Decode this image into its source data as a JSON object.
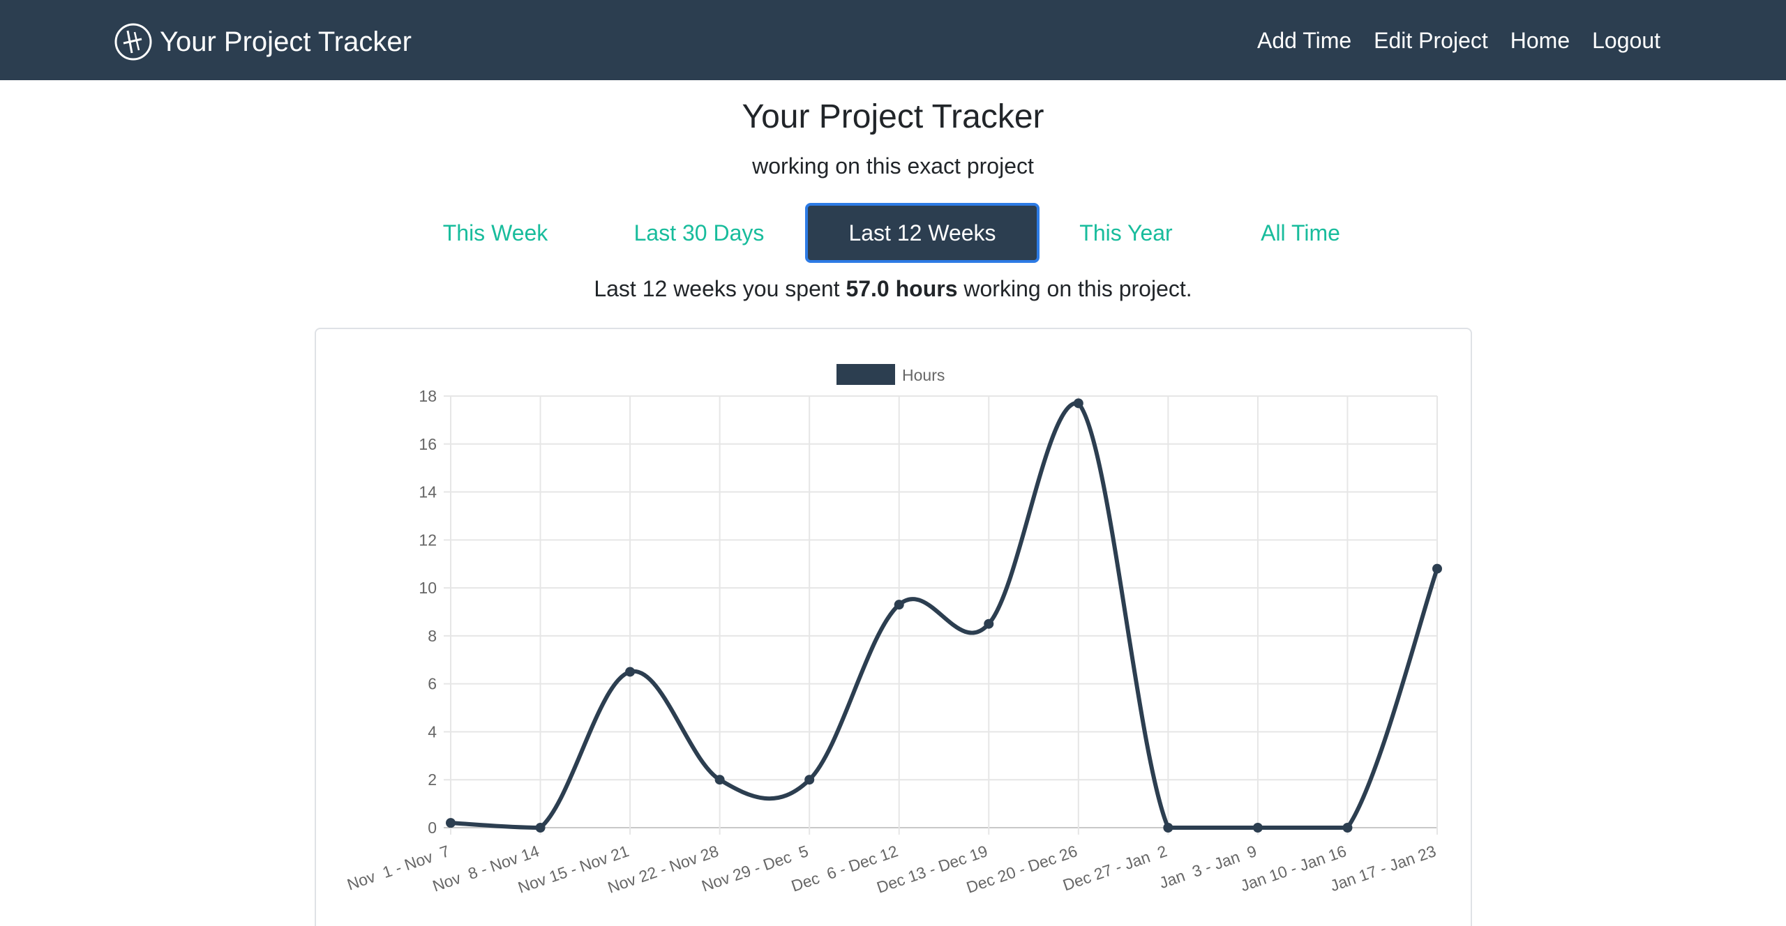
{
  "navbar": {
    "brand": "Your Project Tracker",
    "links": [
      "Add Time",
      "Edit Project",
      "Home",
      "Logout"
    ]
  },
  "header": {
    "title": "Your Project Tracker",
    "subtitle": "working on this exact project"
  },
  "tabs": [
    "This Week",
    "Last 30 Days",
    "Last 12 Weeks",
    "This Year",
    "All Time"
  ],
  "active_tab": "Last 12 Weeks",
  "summary": {
    "prefix": "Last 12 weeks you spent",
    "hours": "57.0 hours",
    "suffix": "working on this project."
  },
  "colors": {
    "navbar": "#2c3e50",
    "accent": "#18bc9c",
    "active_border": "#2d7be5",
    "series": "#2c3e50"
  },
  "chart_data": {
    "type": "line",
    "title": "",
    "xlabel": "",
    "ylabel": "",
    "legend": "top-center",
    "grid": true,
    "ylim": [
      0,
      18
    ],
    "yticks": [
      0,
      2,
      4,
      6,
      8,
      10,
      12,
      14,
      16,
      18
    ],
    "categories": [
      "Nov  1 - Nov  7",
      "Nov  8 - Nov 14",
      "Nov 15 - Nov 21",
      "Nov 22 - Nov 28",
      "Nov 29 - Dec  5",
      "Dec  6 - Dec 12",
      "Dec 13 - Dec 19",
      "Dec 20 - Dec 26",
      "Dec 27 - Jan  2",
      "Jan  3 - Jan  9",
      "Jan 10 - Jan 16",
      "Jan 17 - Jan 23"
    ],
    "series": [
      {
        "name": "Hours",
        "values": [
          0.2,
          0,
          6.5,
          2.0,
          2.0,
          9.3,
          8.5,
          17.7,
          0,
          0,
          0,
          10.8
        ]
      }
    ]
  }
}
